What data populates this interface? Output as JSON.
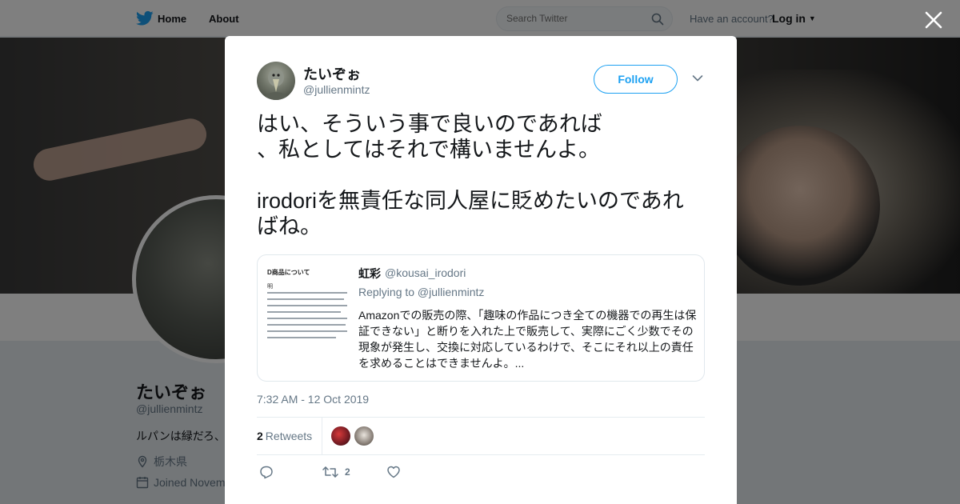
{
  "topbar": {
    "home_label": "Home",
    "about_label": "About",
    "search_placeholder": "Search Twitter",
    "have_account": "Have an account?",
    "login_label": "Log in"
  },
  "profile": {
    "name": "たいぞぉ",
    "handle": "@jullienmintz",
    "bio": "ルパンは緑だろ、",
    "location": "栃木県",
    "joined": "Joined Novem"
  },
  "tweet": {
    "author_name": "たいぞぉ",
    "author_handle": "@jullienmintz",
    "follow_label": "Follow",
    "text": "はい、そういう事で良いのであれば\n、私としてはそれで構いませんよ。\n\nirodoriを無責任な同人屋に貶めたいのであれ\nばね。",
    "timestamp": "7:32 AM - 12 Oct 2019",
    "retweet_count": "2",
    "retweet_label": "Retweets",
    "action_retweet_count": "2"
  },
  "quoted": {
    "author_name": "虹彩",
    "author_handle": "@kousai_irodori",
    "replying_to": "Replying to @jullienmintz",
    "text": "Amazonでの販売の際、「趣味の作品につき全ての機器での再生は保証できない」と断りを入れた上で販売して、実際にごく少数でその現象が発生し、交換に対応しているわけで、そこにそれ以上の責任を求めることはできませんよ。...",
    "thumb_title": "D商品について",
    "thumb_sub": "明"
  },
  "colors": {
    "accent": "#1da1f2",
    "text": "#14171a",
    "muted": "#657786",
    "border": "#e6ecf0"
  }
}
